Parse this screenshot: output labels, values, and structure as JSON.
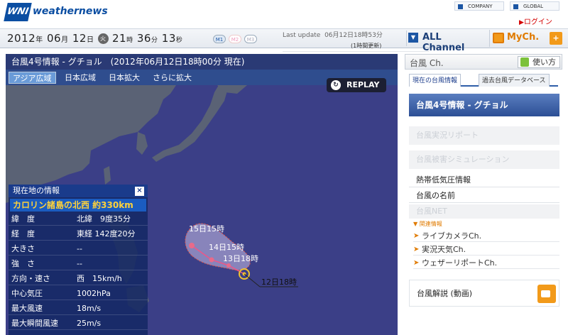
{
  "header": {
    "logo_mark": "WNI",
    "logo_text": "weathernews",
    "company_link": "COMPANY",
    "global_link": "GLOBAL",
    "login": "ログイン"
  },
  "datebar": {
    "year": "2012",
    "year_unit": "年",
    "month": "06",
    "month_unit": "月",
    "day": "12",
    "day_unit": "日",
    "weekday": "火",
    "hour": "21",
    "hour_unit": "時",
    "minute": "36",
    "minute_unit": "分",
    "second": "13",
    "second_unit": "秒",
    "badges": [
      "M1",
      "M2",
      "M3"
    ],
    "last_update_label": "Last update",
    "last_update_value": "06月12日18時53分",
    "last_update_sub": "(1時間更新)",
    "all_channel": "ALL Channel",
    "mych": "MyCh.",
    "plus": "+"
  },
  "map": {
    "title": "台風4号情報 - グチョル　(2012年06月12日18時00分 現在)",
    "tabs": [
      "アジア広域",
      "日本広域",
      "日本拡大",
      "さらに拡大"
    ],
    "active_tab": 0,
    "replay": "REPLAY",
    "track_labels": [
      "15日15時",
      "14日15時",
      "13日18時",
      "12日18時"
    ]
  },
  "info": {
    "title": "現在地の情報",
    "close": "×",
    "location": "カロリン諸島の北西 約330km",
    "rows": [
      {
        "k": "緯　度",
        "v": "北緯　9度35分"
      },
      {
        "k": "経　度",
        "v": "東経 142度20分"
      },
      {
        "k": "大きさ",
        "v": "--"
      },
      {
        "k": "強　さ",
        "v": "--"
      },
      {
        "k": "方向・速さ",
        "v": "西　15km/h"
      },
      {
        "k": "中心気圧",
        "v": "1002hPa"
      },
      {
        "k": "最大風速",
        "v": "18m/s"
      },
      {
        "k": "最大瞬間風速",
        "v": "25m/s"
      }
    ]
  },
  "right": {
    "channel": "台風 Ch.",
    "howto": "使い方",
    "tab_current": "現在の台風情報",
    "tab_db": "過去台風データベース",
    "title": "台風4号情報 - グチョル",
    "disabled_1": "台風実況リポート",
    "disabled_2": "台風被害シミュレーション",
    "link_1": "熱帯低気圧情報",
    "link_2": "台風の名前",
    "disabled_3": "台風NET",
    "related": "▼ 関連情報",
    "sub_links": [
      "ライブカメラCh.",
      "実況天気Ch.",
      "ウェザーリポートCh."
    ],
    "commentary": "台風解説 (動画)"
  }
}
